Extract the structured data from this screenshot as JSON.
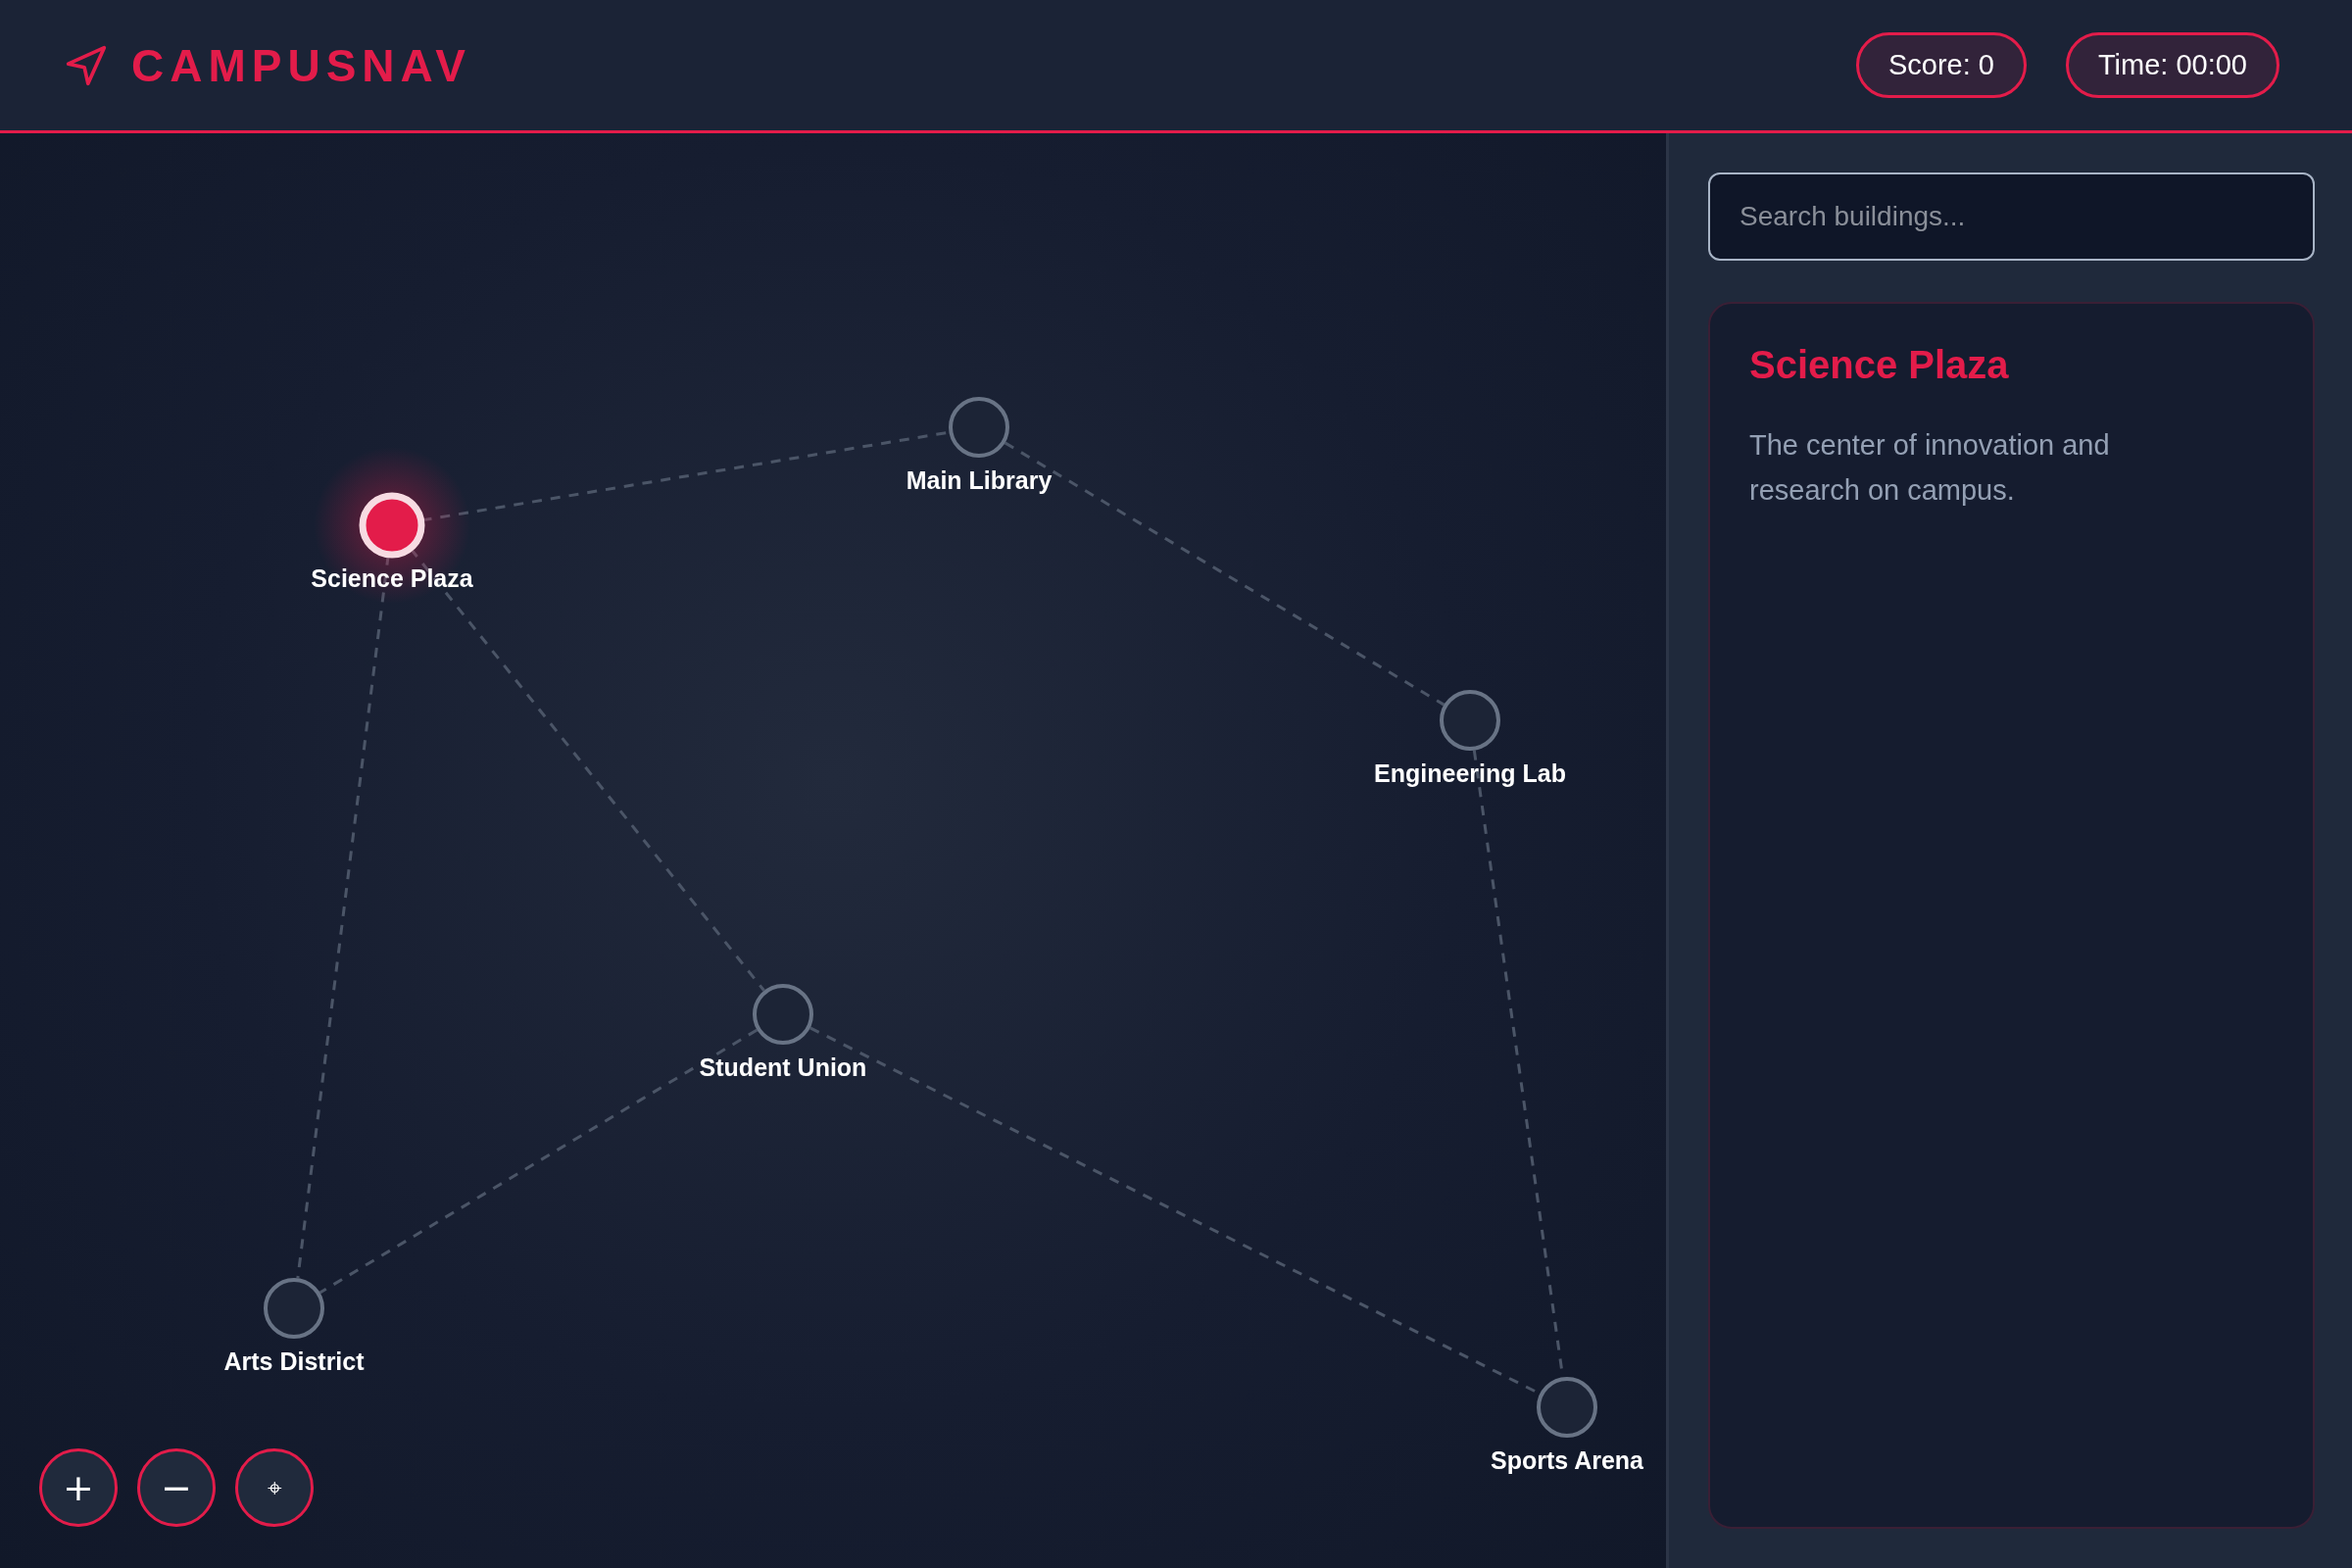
{
  "header": {
    "title": "CAMPUSNAV",
    "stats": [
      "Score: 0",
      "Time: 00:00"
    ]
  },
  "map": {
    "nodes": [
      {
        "name": "Science Plaza",
        "selected": true
      },
      {
        "name": "Main Library",
        "selected": false
      },
      {
        "name": "Engineering Lab",
        "selected": false
      },
      {
        "name": "Student Union",
        "selected": false
      },
      {
        "name": "Arts District",
        "selected": false
      },
      {
        "name": "Sports Arena",
        "selected": false
      }
    ],
    "controls": [
      {
        "kind": "zoom-in",
        "label": "+"
      },
      {
        "kind": "zoom-out",
        "label": "−"
      },
      {
        "kind": "recenter",
        "label": "⌖"
      }
    ]
  },
  "sidebar": {
    "search": {
      "placeholder": "Search buildings..."
    },
    "info": {
      "title": "Science Plaza",
      "description": "The center of innovation and research on campus."
    }
  }
}
